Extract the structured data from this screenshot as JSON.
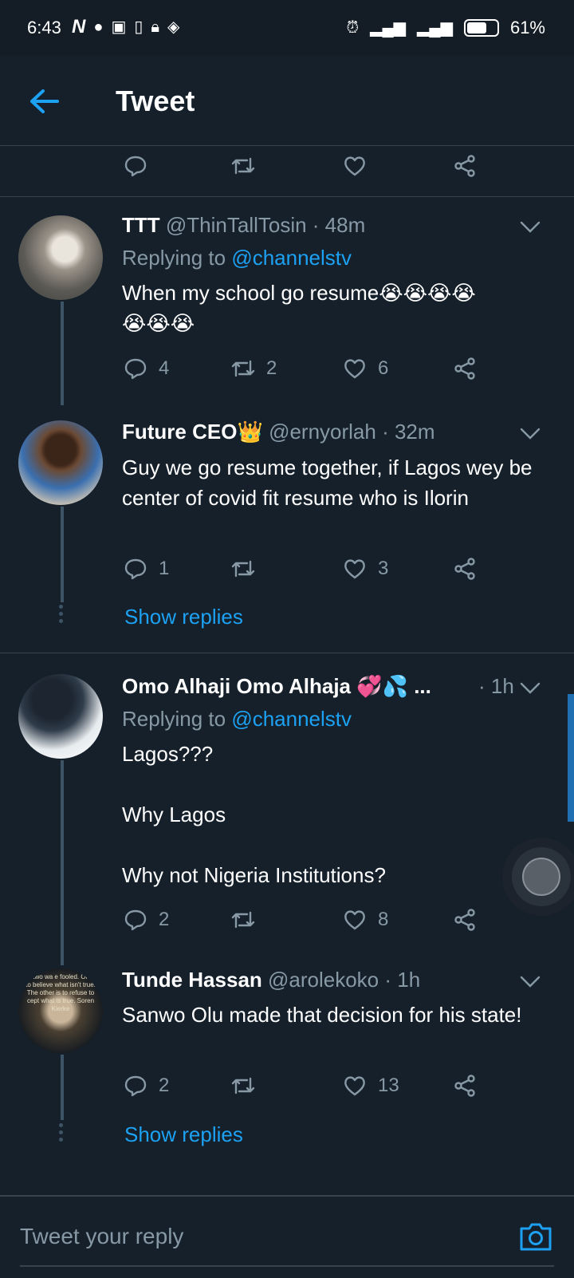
{
  "status_bar": {
    "time": "6:43",
    "battery": "61%",
    "icons": [
      "n-icon",
      "chat-icon",
      "image-icon",
      "sim-icon",
      "lock-icon",
      "layers-icon",
      "alarm-icon",
      "signal-icon",
      "signal2-icon",
      "battery-icon"
    ]
  },
  "header": {
    "title": "Tweet"
  },
  "tweets": [
    {
      "name": "TTT",
      "handle": "@ThinTallTosin · 48m",
      "reply_prefix": "Replying to ",
      "reply_target": "@channelstv",
      "text": "When my school go resume😭😭😭😭",
      "text2": "😭😭😭",
      "replies": "4",
      "retweets": "2",
      "likes": "6"
    },
    {
      "name": "Future CEO👑",
      "handle": "@ernyorlah · 32m",
      "text": "Guy we go resume together, if Lagos wey be center of covid fit resume who is Ilorin",
      "replies": "1",
      "retweets": "",
      "likes": "3",
      "show_replies": "Show replies"
    },
    {
      "name": "Omo Alhaji Omo Alhaja 💞💦 ...",
      "handle": "· 1h",
      "reply_prefix": "Replying to ",
      "reply_target": "@channelstv",
      "text": "Lagos???\n\nWhy Lagos\n\nWhy not Nigeria Institutions?",
      "replies": "2",
      "retweets": "",
      "likes": "8"
    },
    {
      "name": "Tunde Hassan",
      "handle": "@arolekoko · 1h",
      "text": "Sanwo Olu made that decision for his state!",
      "replies": "2",
      "retweets": "",
      "likes": "13",
      "show_replies": "Show replies"
    }
  ],
  "avatar_quote": "are two wa e fooled. One is to believe what isn't true. The other is to refuse to cept what is true. Soren Kierke",
  "compose": {
    "placeholder": "Tweet your reply"
  },
  "colors": {
    "background": "#15202b",
    "accent": "#1da1f2",
    "muted": "#8899a6",
    "divider": "#38444d"
  }
}
